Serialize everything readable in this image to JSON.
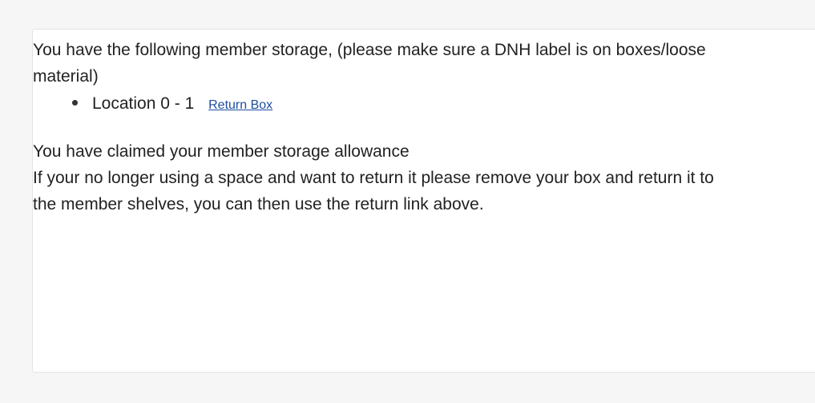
{
  "storage_info": {
    "intro_text": "You have the following member storage, (please make sure a DNH label is on boxes/loose material)",
    "items": [
      {
        "location": "Location 0 - 1",
        "return_label": "Return Box"
      }
    ],
    "allowance_text": "You have claimed your member storage allowance",
    "return_instructions": "If your no longer using a space and want to return it please remove your box and return it to the member shelves, you can then use the return link above."
  },
  "colors": {
    "background": "#f6f6f6",
    "card": "#ffffff",
    "text": "#222222",
    "link": "#1f4ea1"
  }
}
